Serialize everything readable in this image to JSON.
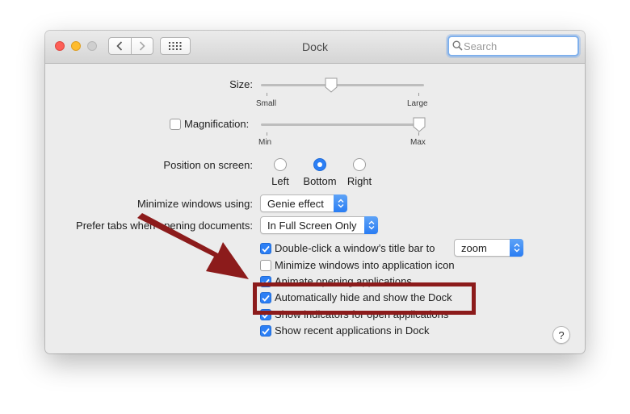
{
  "window": {
    "title": "Dock",
    "search_placeholder": "Search"
  },
  "size": {
    "label": "Size:",
    "min_label": "Small",
    "max_label": "Large",
    "value": 0.43
  },
  "magnification": {
    "label": "Magnification:",
    "checked": false,
    "min_label": "Min",
    "max_label": "Max",
    "value": 0.97
  },
  "position": {
    "label": "Position on screen:",
    "options": [
      "Left",
      "Bottom",
      "Right"
    ],
    "selected": "Bottom"
  },
  "minimize": {
    "label": "Minimize windows using:",
    "value": "Genie effect"
  },
  "prefer_tabs": {
    "label": "Prefer tabs when opening documents:",
    "value": "In Full Screen Only"
  },
  "options": [
    {
      "label": "Double-click a window’s title bar to",
      "checked": true
    },
    {
      "label": "Minimize windows into application icon",
      "checked": false
    },
    {
      "label": "Animate opening applications",
      "checked": true
    },
    {
      "label": "Automatically hide and show the Dock",
      "checked": true
    },
    {
      "label": "Show indicators for open applications",
      "checked": true
    },
    {
      "label": "Show recent applications in Dock",
      "checked": true
    }
  ],
  "double_click_action": "zoom",
  "help_label": "?",
  "colors": {
    "accent": "#2c7ff5",
    "annotation": "#8c1b1b"
  }
}
